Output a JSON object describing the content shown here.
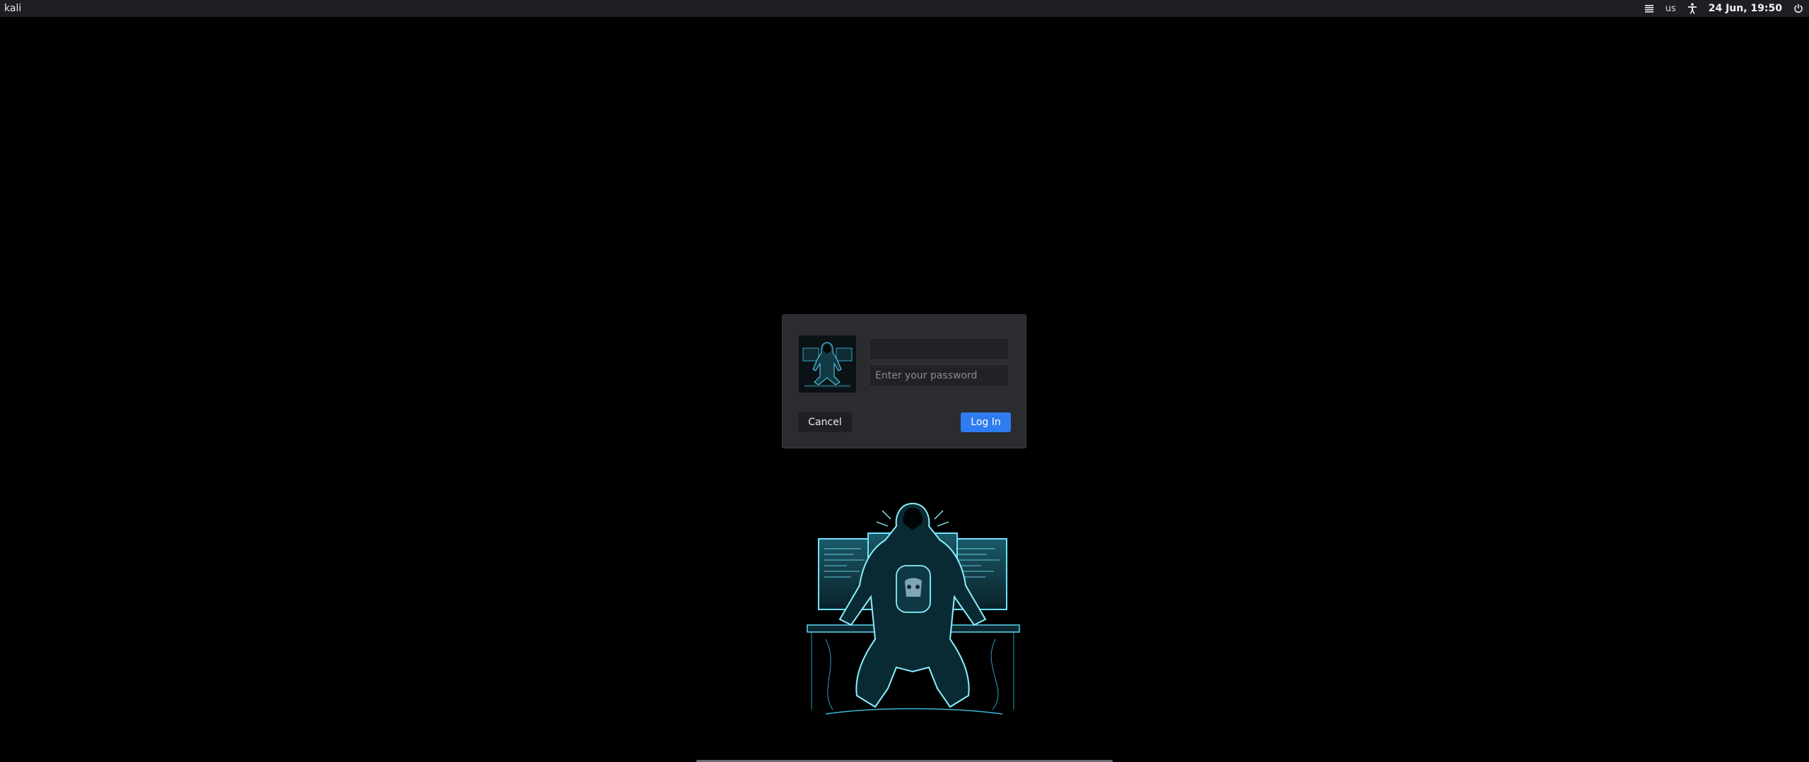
{
  "topbar": {
    "hostname": "kali",
    "keyboard_layout": "us",
    "clock": "24 Jun, 19:50",
    "icons": [
      "menu-icon",
      "accessibility-icon",
      "power-icon"
    ]
  },
  "login": {
    "username_value": "",
    "password_placeholder": "Enter your password",
    "cancel_label": "Cancel",
    "login_label": "Log In"
  },
  "colors": {
    "background": "#000000",
    "topbar": "#1e1f23",
    "dialog": "#2b2c30",
    "accent": "#2f7bf0",
    "neon": "#39c6e6"
  }
}
